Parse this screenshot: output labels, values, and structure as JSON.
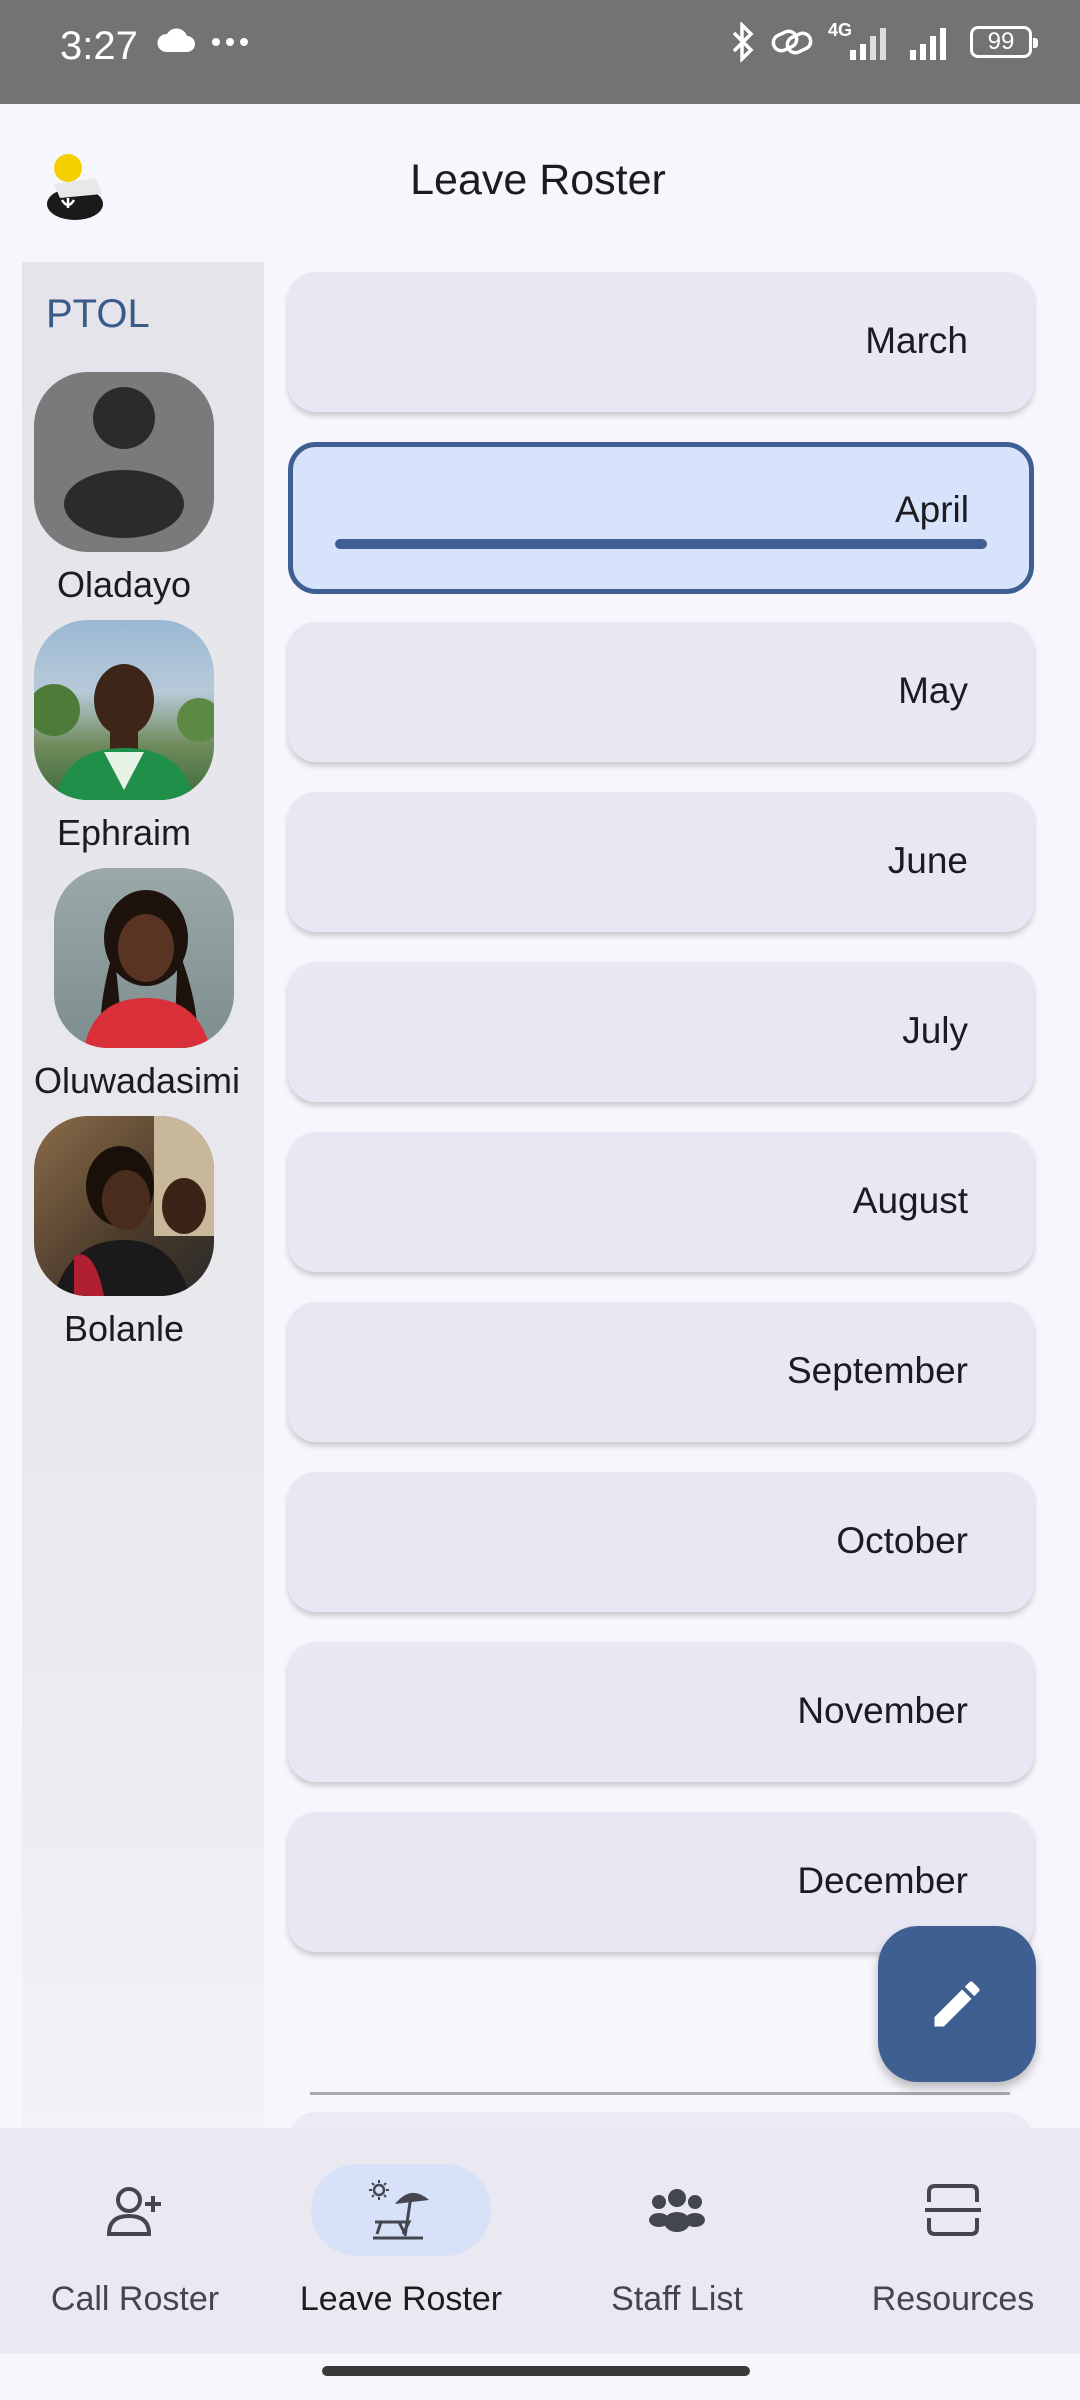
{
  "status_bar": {
    "time": "3:27",
    "network": "4G",
    "battery": "99",
    "icons": [
      "cloud-icon",
      "more-icon",
      "bluetooth-icon",
      "link-icon",
      "signal-icon",
      "signal-icon",
      "battery-icon"
    ]
  },
  "header": {
    "title": "Leave Roster",
    "logo": "app-logo-icon"
  },
  "sidebar": {
    "team": "PTOL",
    "staff": [
      {
        "name": "Oladayo",
        "avatar": "default-avatar"
      },
      {
        "name": "Ephraim",
        "avatar": "photo"
      },
      {
        "name": "Oluwadasimi",
        "avatar": "photo"
      },
      {
        "name": "Bolanle",
        "avatar": "photo"
      }
    ]
  },
  "months": [
    {
      "label": "March",
      "selected": false
    },
    {
      "label": "April",
      "selected": true
    },
    {
      "label": "May",
      "selected": false
    },
    {
      "label": "June",
      "selected": false
    },
    {
      "label": "July",
      "selected": false
    },
    {
      "label": "August",
      "selected": false
    },
    {
      "label": "September",
      "selected": false
    },
    {
      "label": "October",
      "selected": false
    },
    {
      "label": "November",
      "selected": false
    },
    {
      "label": "December",
      "selected": false
    }
  ],
  "fab": {
    "icon": "edit-pencil-icon"
  },
  "bottom_nav": {
    "items": [
      {
        "label": "Call Roster",
        "icon": "add-person-icon",
        "active": false
      },
      {
        "label": "Leave Roster",
        "icon": "beach-umbrella-icon",
        "active": true
      },
      {
        "label": "Staff List",
        "icon": "group-icon",
        "active": false
      },
      {
        "label": "Resources",
        "icon": "resources-icon",
        "active": false
      }
    ]
  },
  "colors": {
    "accent": "#3f5f92",
    "selected_card": "#d6e3fb",
    "card": "#e8e7f3",
    "nav_bg": "#eae9f1"
  }
}
